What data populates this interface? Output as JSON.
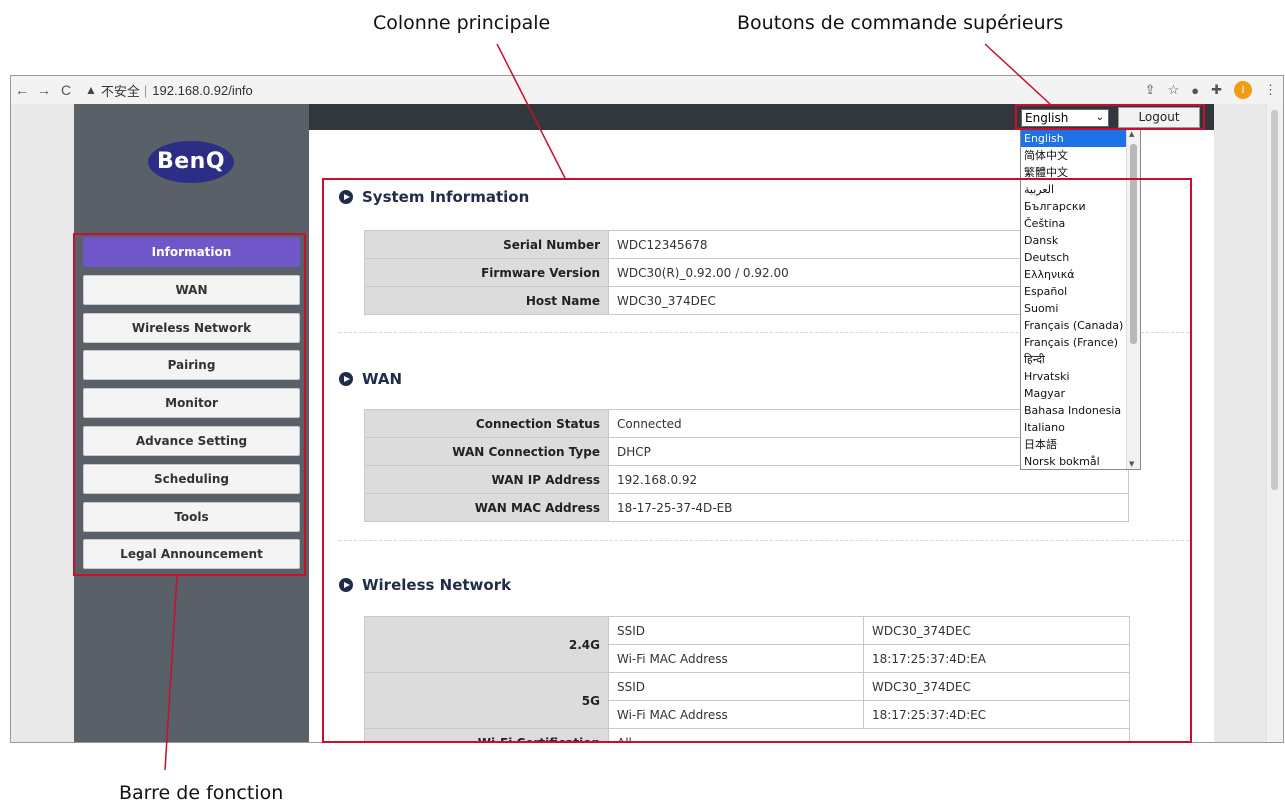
{
  "callouts": {
    "main_column": "Colonne principale",
    "top_buttons": "Boutons de commande supérieurs",
    "function_bar": "Barre de fonction"
  },
  "browser": {
    "back": "←",
    "forward": "→",
    "reload": "C",
    "security_icon": "▲",
    "security_label": "不安全",
    "separator": "|",
    "url": "192.168.0.92/info",
    "tool_icons": [
      "share-icon",
      "star-icon",
      "extension-icon",
      "puzzle-icon"
    ],
    "profile_initial": "I",
    "menu": "⋮"
  },
  "sidebar": {
    "logo_text": "BenQ",
    "items": [
      {
        "label": "Information",
        "active": true
      },
      {
        "label": "WAN",
        "active": false
      },
      {
        "label": "Wireless Network",
        "active": false
      },
      {
        "label": "Pairing",
        "active": false
      },
      {
        "label": "Monitor",
        "active": false
      },
      {
        "label": "Advance Setting",
        "active": false
      },
      {
        "label": "Scheduling",
        "active": false
      },
      {
        "label": "Tools",
        "active": false
      },
      {
        "label": "Legal Announcement",
        "active": false
      }
    ]
  },
  "topbar": {
    "language": "English",
    "logout": "Logout"
  },
  "language_options": [
    "English",
    "简体中文",
    "繁體中文",
    "العربية",
    "Български",
    "Čeština",
    "Dansk",
    "Deutsch",
    "Ελληνικά",
    "Español",
    "Suomi",
    "Français (Canada)",
    "Français (France)",
    "हिन्दी",
    "Hrvatski",
    "Magyar",
    "Bahasa Indonesia",
    "Italiano",
    "日本語",
    "Norsk bokmål"
  ],
  "system_info": {
    "title": "System Information",
    "rows": [
      {
        "label": "Serial Number",
        "value": "WDC12345678"
      },
      {
        "label": "Firmware Version",
        "value": "WDC30(R)_0.92.00 / 0.92.00"
      },
      {
        "label": "Host Name",
        "value": "WDC30_374DEC"
      }
    ]
  },
  "wan": {
    "title": "WAN",
    "rows": [
      {
        "label": "Connection Status",
        "value": "Connected"
      },
      {
        "label": "WAN Connection Type",
        "value": "DHCP"
      },
      {
        "label": "WAN IP Address",
        "value": "192.168.0.92"
      },
      {
        "label": "WAN MAC Address",
        "value": "18-17-25-37-4D-EB"
      }
    ]
  },
  "wireless": {
    "title": "Wireless Network",
    "bands": [
      {
        "band": "2.4G",
        "ssid_label": "SSID",
        "ssid": "WDC30_374DEC",
        "mac_label": "Wi-Fi MAC Address",
        "mac": "18:17:25:37:4D:EA"
      },
      {
        "band": "5G",
        "ssid_label": "SSID",
        "ssid": "WDC30_374DEC",
        "mac_label": "Wi-Fi MAC Address",
        "mac": "18:17:25:37:4D:EC"
      }
    ],
    "cert_label": "Wi-Fi Certification",
    "cert_value": "All"
  }
}
